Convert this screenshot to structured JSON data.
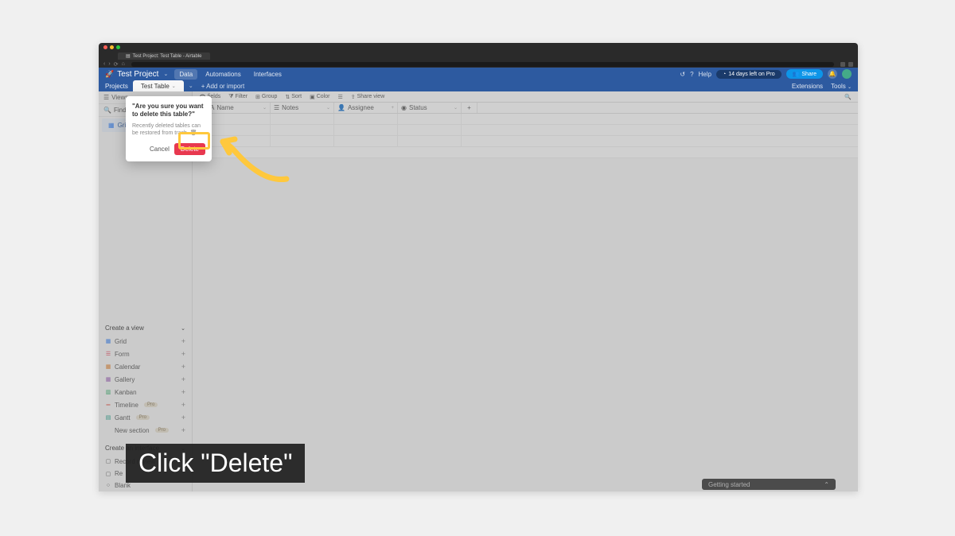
{
  "browser": {
    "tab_title": "Test Project: Test Table - Airtable"
  },
  "header": {
    "project_name": "Test Project",
    "tabs": [
      "Data",
      "Automations",
      "Interfaces"
    ],
    "help_label": "Help",
    "trial_label": "14 days left on Pro",
    "share_label": "Share"
  },
  "secbar": {
    "projects_label": "Projects",
    "table_name": "Test Table",
    "add_import": "Add or import",
    "extensions": "Extensions",
    "tools": "Tools"
  },
  "sidebar": {
    "views_label": "Views",
    "find_label": "Find",
    "grid_view": "Grid v",
    "create_view": "Create a view",
    "view_types": [
      {
        "label": "Grid",
        "icon": "▦",
        "color": "#2d7ff9"
      },
      {
        "label": "Form",
        "icon": "☰",
        "color": "#e8384f"
      },
      {
        "label": "Calendar",
        "icon": "▦",
        "color": "#e67e22"
      },
      {
        "label": "Gallery",
        "icon": "▦",
        "color": "#9b59b6"
      },
      {
        "label": "Kanban",
        "icon": "▥",
        "color": "#27ae60"
      },
      {
        "label": "Timeline",
        "icon": "═",
        "color": "#e74c3c",
        "pro": true
      },
      {
        "label": "Gantt",
        "icon": "▤",
        "color": "#16a085",
        "pro": true
      },
      {
        "label": "New section",
        "icon": "",
        "color": "#888",
        "pro": true
      }
    ],
    "create_interface": "Create an interface",
    "interface_types": [
      {
        "label": "Record review"
      },
      {
        "label": "Re"
      },
      {
        "label": "Blank"
      }
    ],
    "pro_label": "Pro"
  },
  "toolbar": {
    "fields": "fields",
    "filter": "Filter",
    "group": "Group",
    "sort": "Sort",
    "color": "Color",
    "share_view": "Share view"
  },
  "columns": {
    "name": "Name",
    "notes": "Notes",
    "assignee": "Assignee",
    "status": "Status"
  },
  "dialog": {
    "title": "\"Are you sure you want to delete this table?\"",
    "subtitle": "Recently deleted tables can be restored from trash.",
    "cancel": "Cancel",
    "delete": "Delete"
  },
  "getting_started": "Getting started",
  "caption": "Click \"Delete\""
}
